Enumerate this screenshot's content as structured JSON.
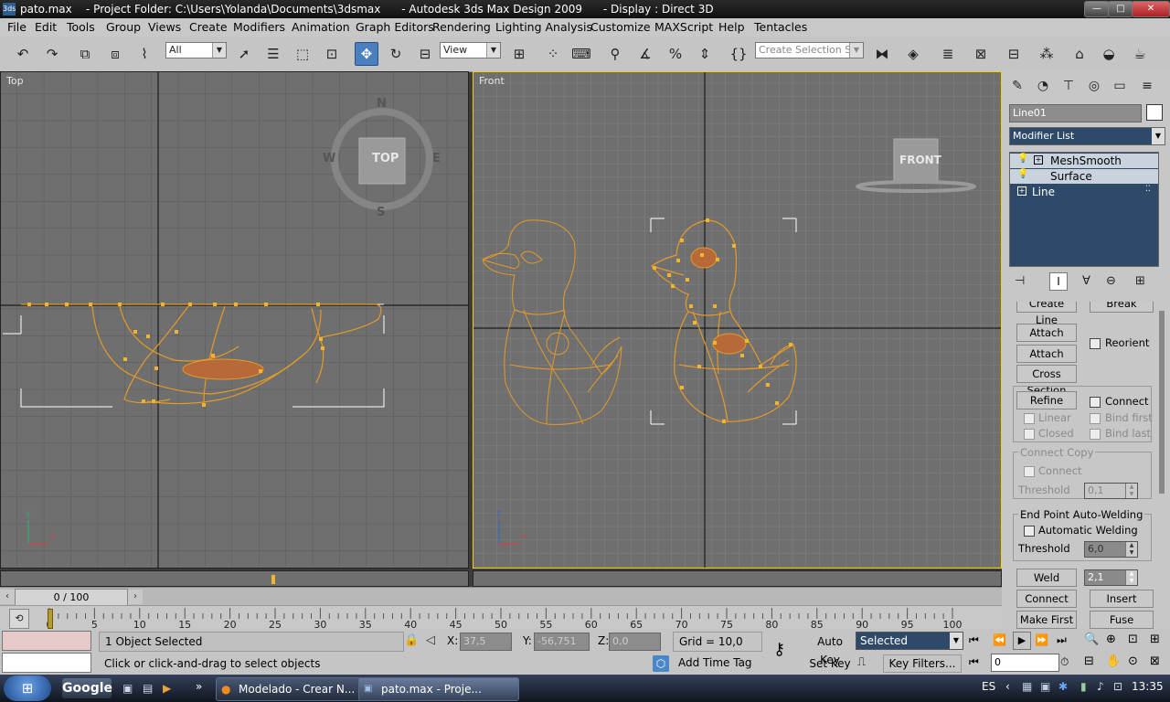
{
  "window": {
    "title": "pato.max    - Project Folder: C:\\Users\\Yolanda\\Documents\\3dsmax      - Autodesk 3ds Max Design 2009      - Display : Direct 3D",
    "app_icon": "3ds",
    "controls": {
      "minimize": "—",
      "maximize": "□",
      "close": "✕"
    }
  },
  "menu": [
    "File",
    "Edit",
    "Tools",
    "Group",
    "Views",
    "Create",
    "Modifiers",
    "Animation",
    "Graph Editors",
    "Rendering",
    "Lighting Analysis",
    "Customize",
    "MAXScript",
    "Help",
    "Tentacles"
  ],
  "toolbar": {
    "filter_value": "All",
    "ref_coord_value": "View",
    "selection_set_placeholder": "Create Selection Se",
    "icons": [
      "undo-icon",
      "redo-icon",
      "select-link-icon",
      "unlink-icon",
      "bind-spacewarp-icon",
      "select-icon",
      "select-by-name-icon",
      "rect-region-icon",
      "window-crossing-icon",
      "move-icon",
      "rotate-icon",
      "scale-icon",
      "pivot-icon",
      "manipulate-icon",
      "snap-icon",
      "angle-snap-icon",
      "percent-snap-icon",
      "spinner-snap-icon",
      "named-sel-icon",
      "mirror-icon",
      "align-icon",
      "layers-icon",
      "curve-editor-icon",
      "schematic-icon",
      "material-editor-icon",
      "render-setup-icon",
      "render-frame-icon",
      "quick-render-icon"
    ]
  },
  "viewports": {
    "top": {
      "label": "Top",
      "cube_label": "TOP",
      "compass": {
        "n": "N",
        "s": "S",
        "w": "W",
        "e": "E"
      }
    },
    "front": {
      "label": "Front",
      "cube_label": "FRONT"
    },
    "axis": {
      "x": "x",
      "y": "y",
      "z": "z"
    }
  },
  "command_panel": {
    "object_name": "Line01",
    "modifier_list": "Modifier List",
    "stack": [
      "MeshSmooth",
      "Surface",
      "Line"
    ],
    "buttons": {
      "create_line": "Create Line",
      "break": "Break",
      "attach": "Attach",
      "reorient": "Reorient",
      "attach_mult": "Attach Mult.",
      "cross_section": "Cross Section",
      "refine": "Refine",
      "connect": "Connect",
      "linear": "Linear",
      "bind_first": "Bind first",
      "closed": "Closed",
      "bind_last": "Bind last",
      "connect_copy": "Connect Copy",
      "connect_copy_chk": "Connect",
      "threshold": "Threshold",
      "threshold_value": "0,1",
      "end_point_auto_welding": "End Point Auto-Welding",
      "automatic_welding": "Automatic Welding",
      "weld_threshold": "Threshold",
      "weld_threshold_value": "6,0",
      "weld": "Weld",
      "weld_value": "2,1",
      "connect_btn": "Connect",
      "insert": "Insert",
      "make_first": "Make First",
      "fuse": "Fuse"
    }
  },
  "time": {
    "slider_label": "0 / 100",
    "ticks": [
      "0",
      "5",
      "10",
      "15",
      "20",
      "25",
      "30",
      "35",
      "40",
      "45",
      "50",
      "55",
      "60",
      "65",
      "70",
      "75",
      "80",
      "85",
      "90",
      "95",
      "100"
    ],
    "current_frame": 0
  },
  "status": {
    "selection": "1 Object Selected",
    "prompt": "Click or click-and-drag to select objects",
    "x_label": "X:",
    "x_value": "37,5",
    "y_label": "Y:",
    "y_value": "-56,751",
    "z_label": "Z:",
    "z_value": "0,0",
    "grid": "Grid = 10,0",
    "auto_key": "Auto Key",
    "selected": "Selected",
    "set_key": "Set Key",
    "key_filters": "Key Filters...",
    "add_time_tag": "Add Time Tag",
    "frame_value": "0"
  },
  "taskbar": {
    "google": "Google",
    "quicklaunch_more": "»",
    "tasks": [
      "Modelado - Crear N...",
      "pato.max     - Proje..."
    ],
    "lang": "ES",
    "clock": "13:35"
  },
  "colors": {
    "viewport_bg": "#6f6f6f",
    "spline": "#e59a26",
    "fill": "#b8693a",
    "active_tool": "#4a7fc0"
  }
}
